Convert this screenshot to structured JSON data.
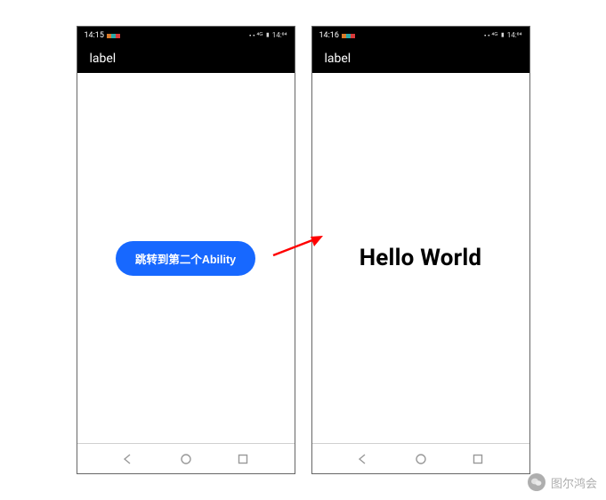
{
  "phone1": {
    "status": {
      "time": "14:15",
      "right": "⬝ ⬝  ⁴ᴳ ▮ 14:⁰⁴"
    },
    "app_bar": {
      "title": "label"
    },
    "button": {
      "label": "跳转到第二个Ability"
    }
  },
  "phone2": {
    "status": {
      "time": "14:16",
      "right": "⬝ ⬝  ⁴ᴳ ▮ 14:⁰⁴"
    },
    "app_bar": {
      "title": "label"
    },
    "text": "Hello World"
  },
  "watermark": {
    "label": "图尔鸿会"
  }
}
